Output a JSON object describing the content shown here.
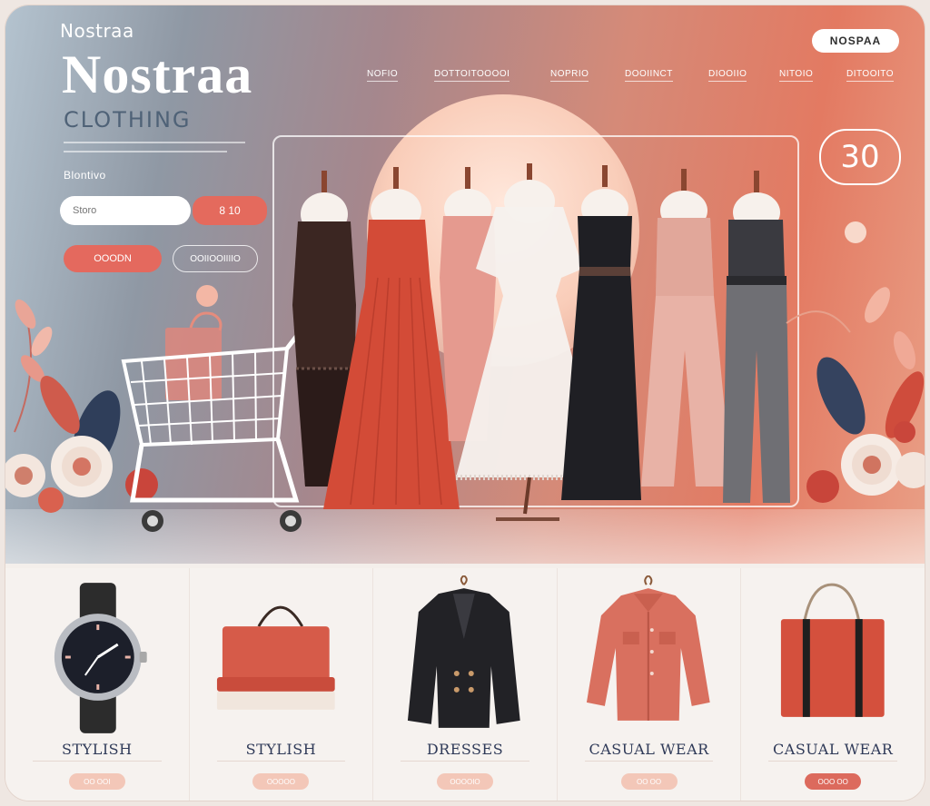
{
  "brand": {
    "small": "Nostraa",
    "name": "Nostraa",
    "subtitle": "CLOTHING",
    "pill": "NOSPAA"
  },
  "hero": {
    "section_label": "Blontivo",
    "search_placeholder": "Storo",
    "search_button": "8 10",
    "shop_now": "OOODN",
    "collection": "OOIIOOIIIIO",
    "promo_badge": "30"
  },
  "nav": {
    "items": [
      "NOFIO",
      "DOTTOITOOOOI",
      "NOPRIO",
      "DOOIINCT",
      "DIOOIIO",
      "NITOIO",
      "DITOOITO"
    ]
  },
  "categories": [
    {
      "label": "STYLISH",
      "button": "OO OOI",
      "icon": "watch-icon",
      "button_color": "#f3c7b8"
    },
    {
      "label": "STYLISH",
      "button": "OOOOO",
      "icon": "handbag-icon",
      "button_color": "#f3c7b8"
    },
    {
      "label": "DRESSES",
      "button": "OOOOIO",
      "icon": "blazer-icon",
      "button_color": "#f3c7b8"
    },
    {
      "label": "CASUAL WEAR",
      "button": "OO OO",
      "icon": "shirt-icon",
      "button_color": "#f3c7b8"
    },
    {
      "label": "CASUAL WEAR",
      "button": "OOO OO",
      "icon": "tote-bag-icon",
      "button_color": "#dc6a5d"
    }
  ],
  "colors": {
    "accent": "#e4695e",
    "hero_left": "#b4c3cf",
    "hero_right": "#e37a62",
    "label_text": "#2f3a58"
  }
}
